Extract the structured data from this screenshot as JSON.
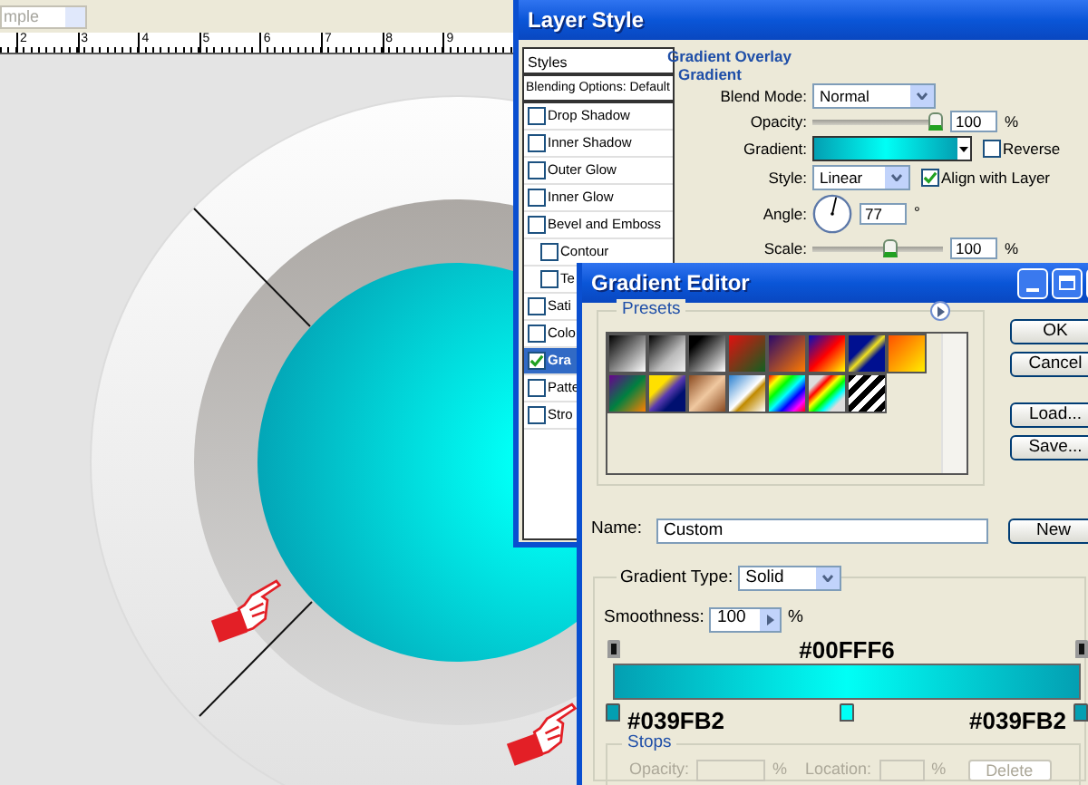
{
  "toolbar": {
    "dropdown_value": "mple"
  },
  "ruler": {
    "ticks": [
      "2",
      "3",
      "4",
      "5",
      "6",
      "7",
      "8",
      "9"
    ]
  },
  "layer_style": {
    "title": "Layer Style",
    "styles_header": "Styles",
    "blending_options": "Blending Options: Default",
    "effects": [
      {
        "label": "Drop Shadow",
        "checked": false,
        "selected": false,
        "kind": "top"
      },
      {
        "label": "Inner Shadow",
        "checked": false,
        "selected": false,
        "kind": "top"
      },
      {
        "label": "Outer Glow",
        "checked": false,
        "selected": false,
        "kind": "top"
      },
      {
        "label": "Inner Glow",
        "checked": false,
        "selected": false,
        "kind": "top"
      },
      {
        "label": "Bevel and Emboss",
        "checked": false,
        "selected": false,
        "kind": "top"
      },
      {
        "label": "Contour",
        "checked": false,
        "selected": false,
        "kind": "sub"
      },
      {
        "label": "Te",
        "checked": false,
        "selected": false,
        "kind": "sub"
      },
      {
        "label": "Sati",
        "checked": false,
        "selected": false,
        "kind": "top"
      },
      {
        "label": "Colo",
        "checked": false,
        "selected": false,
        "kind": "top"
      },
      {
        "label": "Gra",
        "checked": true,
        "selected": true,
        "kind": "top"
      },
      {
        "label": "Patte",
        "checked": false,
        "selected": false,
        "kind": "top"
      },
      {
        "label": "Stro",
        "checked": false,
        "selected": false,
        "kind": "top"
      }
    ],
    "gradient_overlay": {
      "legend": "Gradient Overlay",
      "sublegend": "Gradient",
      "blend_mode_label": "Blend Mode:",
      "blend_mode": "Normal",
      "opacity_label": "Opacity:",
      "opacity_slider": {
        "level": 0.95
      },
      "opacity_value": "100",
      "opacity_unit": "%",
      "gradient_label": "Gradient:",
      "reverse_label": "Reverse",
      "reverse_checked": false,
      "style_label": "Style:",
      "style": "Linear",
      "align_label": "Align with Layer",
      "align_checked": true,
      "angle_label": "Angle:",
      "angle_value": "77",
      "angle_unit": "°",
      "scale_label": "Scale:",
      "scale_slider": {
        "level": 0.6
      },
      "scale_value": "100",
      "scale_unit": "%"
    }
  },
  "gradient_editor": {
    "title": "Gradient Editor",
    "presets_legend": "Presets",
    "buttons": [
      "OK",
      "Cancel",
      "Load...",
      "Save..."
    ],
    "name_label": "Name:",
    "name_value": "Custom",
    "new_button": "New",
    "type_label": "Gradient Type:",
    "type_value": "Solid",
    "smoothness_label": "Smoothness:",
    "smoothness_value": "100",
    "smoothness_unit": "%",
    "opacity_stops": [
      {
        "level": 0
      },
      {
        "level": 1
      }
    ],
    "color_stops": [
      {
        "level": 0,
        "color": "#039fb2",
        "label": "#039FB2",
        "kind": "below"
      },
      {
        "level": 0.5,
        "color": "#00fff6",
        "label": "#00FFF6",
        "kind": "above"
      },
      {
        "level": 1,
        "color": "#039fb2",
        "label": "#039FB2",
        "kind": "below"
      }
    ],
    "stops": {
      "legend": "Stops",
      "opacity_label": "Opacity:",
      "opacity_unit": "%",
      "location_label": "Location:",
      "location_unit": "%",
      "delete_label": "Delete",
      "disabled": true
    }
  }
}
